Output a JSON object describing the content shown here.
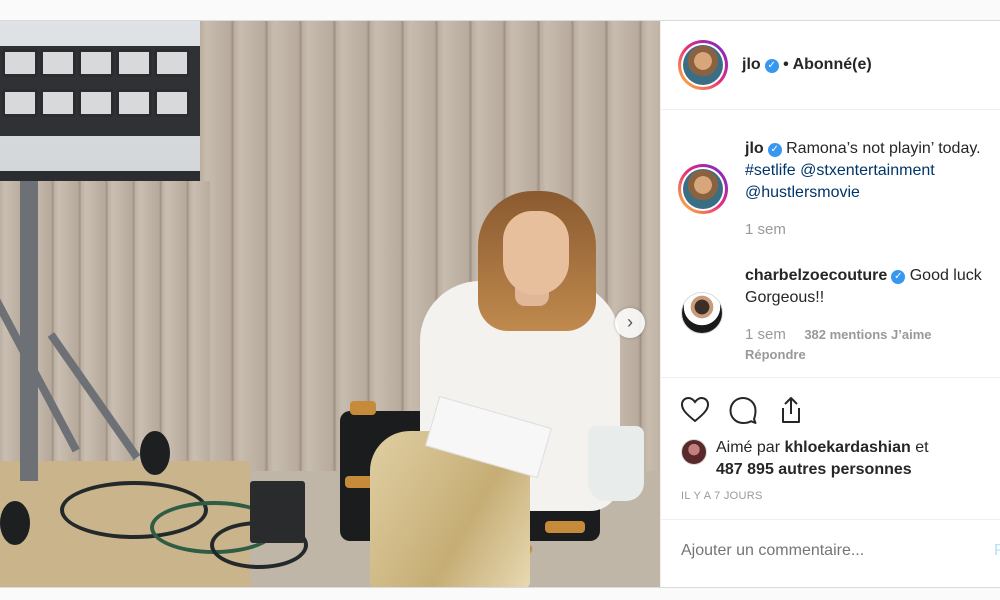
{
  "post": {
    "author": "jlo",
    "follow_state": "Abonné(e)",
    "carousel_next": "›"
  },
  "caption": {
    "author": "jlo",
    "text": "Ramona’s not playin’ today.",
    "tags": [
      "#setlife",
      "@stxentertainment",
      "@hustlersmovie"
    ],
    "time": "1 sem"
  },
  "comment": {
    "author": "charbelzoecouture",
    "text": "Good luck Gorgeous!!",
    "time": "1 sem",
    "likes": "382 mentions J’aime",
    "reply": "Répondre"
  },
  "likes": {
    "prefix": "Aimé par",
    "user": "khloekardashian",
    "suffix": "et",
    "others": "487 895 autres personnes"
  },
  "date": "IL Y A 7 JOURS",
  "comment_box": {
    "placeholder": "Ajouter un commentaire...",
    "publish": "P"
  },
  "colors": {
    "verified": "#3897f0",
    "hashtag": "#003569",
    "muted": "#999999"
  },
  "icons": [
    "heart-icon",
    "comment-icon",
    "share-icon",
    "verified-icon",
    "chevron-right-icon"
  ]
}
